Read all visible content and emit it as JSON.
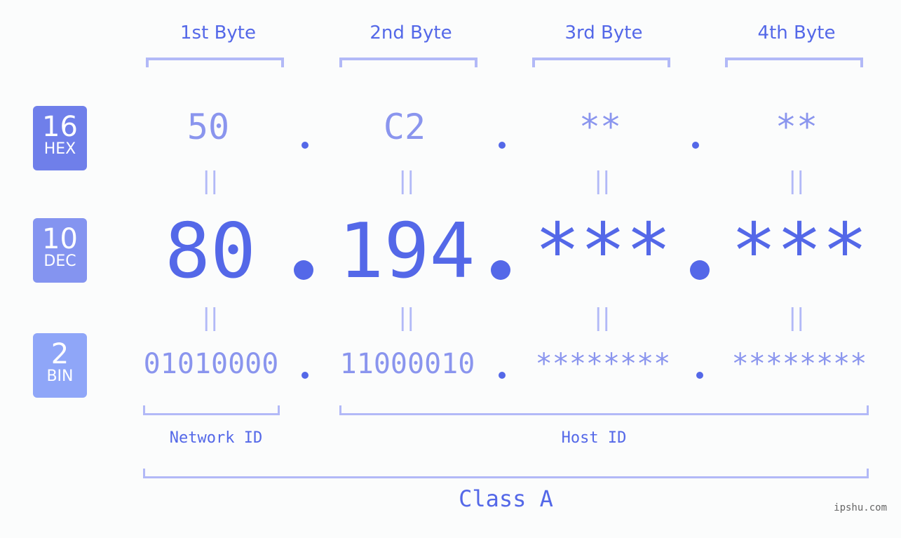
{
  "byte_headers": [
    "1st Byte",
    "2nd Byte",
    "3rd Byte",
    "4th Byte"
  ],
  "badges": [
    {
      "number": "16",
      "label": "HEX",
      "color": "#6f7fea"
    },
    {
      "number": "10",
      "label": "DEC",
      "color": "#8494f0"
    },
    {
      "number": "2",
      "label": "BIN",
      "color": "#8fa6f8"
    }
  ],
  "hex": [
    "50",
    "C2",
    "**",
    "**"
  ],
  "dec": [
    "80",
    "194",
    "***",
    "***"
  ],
  "bin": [
    "01010000",
    "11000010",
    "********",
    "********"
  ],
  "equals_symbol": "||",
  "network_id_label": "Network ID",
  "host_id_label": "Host ID",
  "class_label": "Class A",
  "watermark": "ipshu.com",
  "colors": {
    "accent": "#5468e8",
    "light": "#8a95ee",
    "bracket": "#b2b9f7"
  }
}
